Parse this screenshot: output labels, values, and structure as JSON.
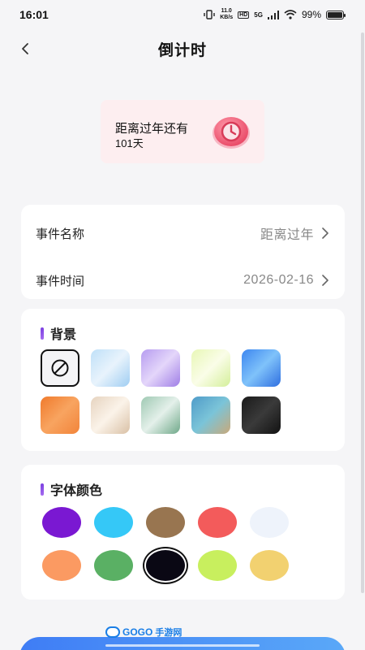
{
  "status_bar": {
    "time": "16:01",
    "speed_value": "11.0",
    "speed_unit": "KB/s",
    "hd": "HD",
    "network": "5G",
    "battery_percent": "99%",
    "battery_level": 0.99
  },
  "nav": {
    "title": "倒计时",
    "back_icon": "chevron-left-icon"
  },
  "preview": {
    "title": "距离过年还有",
    "days": "101天",
    "icon": "clock-icon"
  },
  "event": {
    "name_label": "事件名称",
    "name_value": "距离过年",
    "time_label": "事件时间",
    "time_value": "2026-02-16"
  },
  "background": {
    "title": "背景",
    "options": [
      {
        "name": "none",
        "icon": "no-background-icon",
        "selected": true
      },
      {
        "name": "sky-clouds",
        "colors": [
          "#bfe0f8",
          "#e8f3fc",
          "#9fcdf2"
        ]
      },
      {
        "name": "purple-haze",
        "colors": [
          "#b69cf0",
          "#e4d6fa",
          "#9f7ee6"
        ]
      },
      {
        "name": "lime-glow",
        "colors": [
          "#e8f7b6",
          "#fafde8",
          "#d4ef9a"
        ]
      },
      {
        "name": "blue-gradient",
        "colors": [
          "#3c86f0",
          "#7fc2fa",
          "#2f6fe0"
        ]
      },
      {
        "name": "orange-gradient",
        "colors": [
          "#f07a2c",
          "#f8a460",
          "#f2843a"
        ]
      },
      {
        "name": "silk-cream",
        "colors": [
          "#e6d3bf",
          "#fbf3e9",
          "#d9c0a5"
        ]
      },
      {
        "name": "green-leaves",
        "colors": [
          "#9fc9b3",
          "#e4f0ea",
          "#6fa889"
        ]
      },
      {
        "name": "tropical-beach",
        "colors": [
          "#4f9bc9",
          "#7bc4d8",
          "#c9a97a"
        ]
      },
      {
        "name": "dark-texture",
        "colors": [
          "#1a1a1a",
          "#3a3a3a",
          "#121212"
        ]
      }
    ]
  },
  "font_color": {
    "title": "字体颜色",
    "options": [
      {
        "name": "purple",
        "color": "#7a18d2"
      },
      {
        "name": "sky-blue",
        "color": "#35c8f7"
      },
      {
        "name": "brown",
        "color": "#987550"
      },
      {
        "name": "red",
        "color": "#f35b5b"
      },
      {
        "name": "pale-white",
        "color": "#eef3fb"
      },
      {
        "name": "orange",
        "color": "#fb9a62"
      },
      {
        "name": "green",
        "color": "#5ab064"
      },
      {
        "name": "black",
        "color": "#0a0814",
        "selected": true
      },
      {
        "name": "lime",
        "color": "#c8ef5e"
      },
      {
        "name": "yellow",
        "color": "#f2d170"
      }
    ]
  },
  "watermark": {
    "brand": "GOGO",
    "suffix": "手游网"
  },
  "colors": {
    "accent_purple": "#7b3fe0",
    "button_blue": "#3f7df5",
    "preview_bg": "#fdeef0",
    "clock_red": "#ee5a72"
  }
}
